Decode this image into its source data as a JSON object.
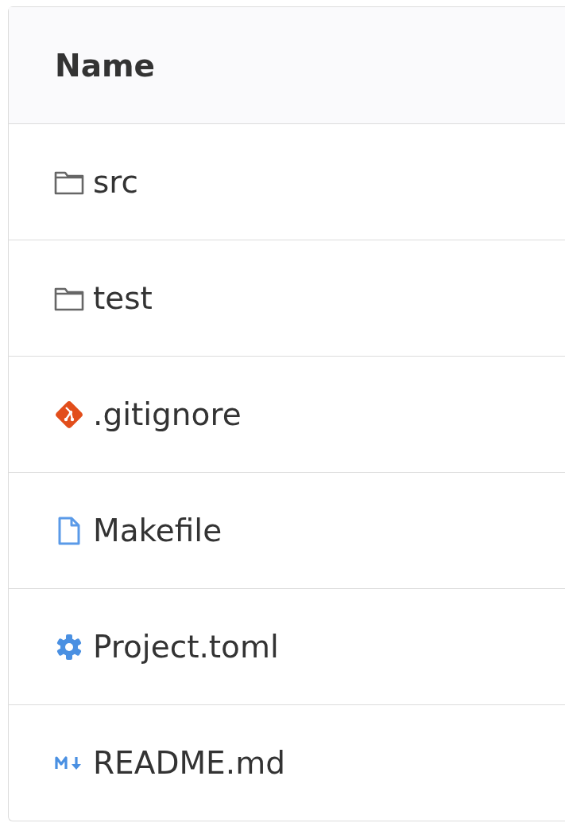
{
  "table": {
    "columns": [
      "Name"
    ],
    "rows": [
      {
        "kind": "folder",
        "name": "src"
      },
      {
        "kind": "folder",
        "name": "test"
      },
      {
        "kind": "git",
        "name": ".gitignore"
      },
      {
        "kind": "file",
        "name": "Makefile"
      },
      {
        "kind": "config",
        "name": "Project.toml"
      },
      {
        "kind": "markdown",
        "name": "README.md"
      }
    ]
  }
}
